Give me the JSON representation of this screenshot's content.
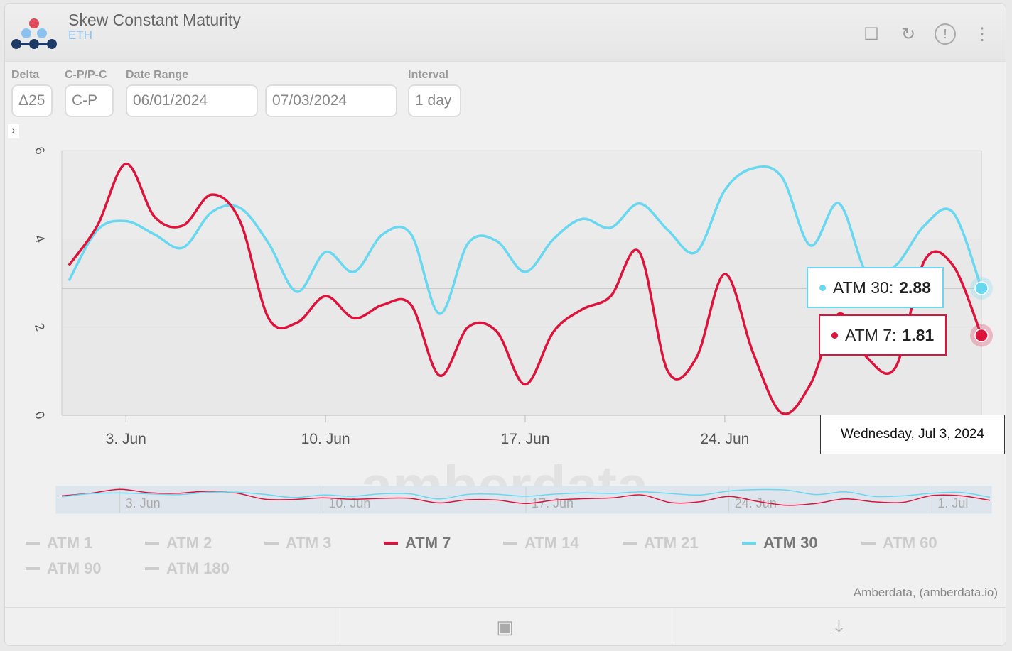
{
  "header": {
    "title": "Skew Constant Maturity",
    "subtitle": "ETH",
    "icons": [
      "bookmark-icon",
      "refresh-icon",
      "alert-icon",
      "more-icon"
    ]
  },
  "controls": {
    "delta_label": "Delta",
    "delta_value": "Δ25",
    "cp_label": "C-P/P-C",
    "cp_value": "C-P",
    "date_label": "Date Range",
    "date_start": "06/01/2024",
    "date_end": "07/03/2024",
    "interval_label": "Interval",
    "interval_value": "1 day"
  },
  "colors": {
    "atm7": "#dc143c",
    "atm30": "#68d8f0",
    "inactive": "#cccccc"
  },
  "watermark": "amberdata",
  "chart_data": {
    "type": "line",
    "x": [
      "2024-06-01",
      "2024-06-02",
      "2024-06-03",
      "2024-06-04",
      "2024-06-05",
      "2024-06-06",
      "2024-06-07",
      "2024-06-08",
      "2024-06-09",
      "2024-06-10",
      "2024-06-11",
      "2024-06-12",
      "2024-06-13",
      "2024-06-14",
      "2024-06-15",
      "2024-06-16",
      "2024-06-17",
      "2024-06-18",
      "2024-06-19",
      "2024-06-20",
      "2024-06-21",
      "2024-06-22",
      "2024-06-23",
      "2024-06-24",
      "2024-06-25",
      "2024-06-26",
      "2024-06-27",
      "2024-06-28",
      "2024-06-29",
      "2024-06-30",
      "2024-07-01",
      "2024-07-02",
      "2024-07-03"
    ],
    "series": [
      {
        "name": "ATM 7",
        "color": "#dc143c",
        "values": [
          3.4,
          4.3,
          5.7,
          4.5,
          4.3,
          5.0,
          4.4,
          2.2,
          2.1,
          2.7,
          2.2,
          2.5,
          2.5,
          0.9,
          2.0,
          1.9,
          0.7,
          1.9,
          2.4,
          2.7,
          3.7,
          1.0,
          1.3,
          3.2,
          1.4,
          0.05,
          0.7,
          2.3,
          1.3,
          1.1,
          3.5,
          3.4,
          1.81
        ]
      },
      {
        "name": "ATM 30",
        "color": "#68d8f0",
        "values": [
          3.05,
          4.2,
          4.4,
          4.1,
          3.8,
          4.6,
          4.7,
          3.9,
          2.8,
          3.7,
          3.25,
          4.1,
          4.1,
          2.3,
          3.9,
          3.95,
          3.25,
          4.0,
          4.45,
          4.25,
          4.8,
          4.2,
          3.7,
          5.1,
          5.6,
          5.4,
          3.85,
          4.8,
          3.2,
          3.4,
          4.3,
          4.6,
          2.88
        ]
      }
    ],
    "ylim": [
      0,
      6
    ],
    "yticks": [
      "0",
      "2",
      "4",
      "6"
    ],
    "xticks": [
      "3. Jun",
      "10. Jun",
      "17. Jun",
      "24. Jun"
    ],
    "navigator_xticks": [
      "3. Jun",
      "10. Jun",
      "17. Jun",
      "24. Jun",
      "1. Jul"
    ],
    "grid": true,
    "legend": {
      "placement": "bottom",
      "items": [
        {
          "label": "ATM 1",
          "active": false
        },
        {
          "label": "ATM 2",
          "active": false
        },
        {
          "label": "ATM 3",
          "active": false
        },
        {
          "label": "ATM 7",
          "active": true,
          "color": "#dc143c"
        },
        {
          "label": "ATM 14",
          "active": false
        },
        {
          "label": "ATM 21",
          "active": false
        },
        {
          "label": "ATM 30",
          "active": true,
          "color": "#68d8f0"
        },
        {
          "label": "ATM 60",
          "active": false
        },
        {
          "label": "ATM 90",
          "active": false
        },
        {
          "label": "ATM 180",
          "active": false
        }
      ]
    },
    "tooltip": {
      "date": "Wednesday, Jul 3, 2024",
      "items": [
        {
          "label": "ATM 30:",
          "value": "2.88"
        },
        {
          "label": "ATM 7:",
          "value": "1.81"
        }
      ]
    }
  },
  "credit": "Amberdata, (amberdata.io)"
}
